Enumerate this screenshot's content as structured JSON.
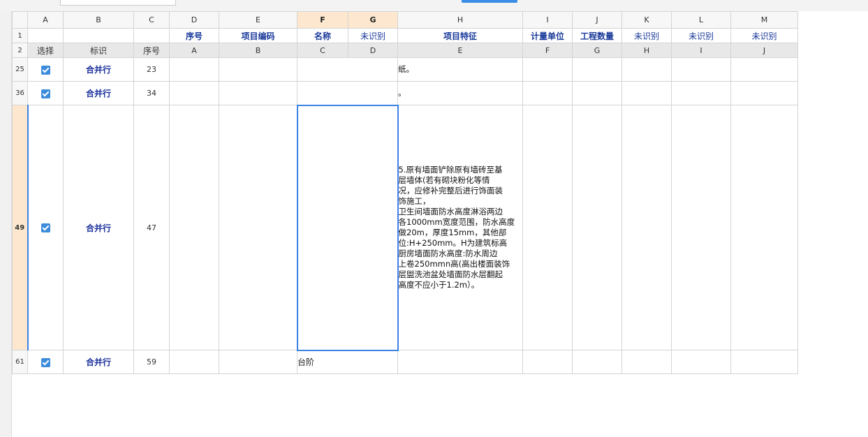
{
  "columns": [
    "A",
    "B",
    "C",
    "D",
    "E",
    "F",
    "G",
    "H",
    "I",
    "J",
    "K",
    "L",
    "M"
  ],
  "header_row1": {
    "row_num": "1",
    "A": "",
    "B": "",
    "C": "",
    "D": "序号",
    "E": "项目编码",
    "F": "名称",
    "G": "未识别",
    "H": "项目特征",
    "I": "计量单位",
    "J": "工程数量",
    "K": "未识别",
    "L": "未识别",
    "M": "未识别"
  },
  "header_row2": {
    "row_num": "2",
    "A": "选择",
    "B": "标识",
    "C": "序号",
    "D": "A",
    "E": "B",
    "F": "C",
    "G": "D",
    "H": "E",
    "I": "F",
    "J": "G",
    "K": "H",
    "L": "I",
    "M": "J"
  },
  "rows": [
    {
      "row_num": "25",
      "checked": true,
      "tag": "合并行",
      "seq": "23",
      "name": "",
      "desc": [
        "纸。"
      ]
    },
    {
      "row_num": "36",
      "checked": true,
      "tag": "合并行",
      "seq": "34",
      "name": "",
      "desc": [
        "。"
      ]
    },
    {
      "row_num": "49",
      "checked": true,
      "tag": "合并行",
      "seq": "47",
      "name": "",
      "desc": [
        "5.原有墙面铲除原有墙砖至基",
        "层墙体(若有砌块粉化等情",
        "况，应修补完整后进行饰面装",
        "饰施工，",
        "卫生间墙面防水高度淋浴两边",
        "各1000mm宽度范围，防水高度",
        "做20m，厚度15mm，其他部",
        "位:H+250mm。H为建筑标高",
        "厨房墙面防水高度:防水周边",
        "上卷250mmn高(高出楼面装饰",
        "层盥洗池盆处墙面防水层翻起",
        "高度不应小于1.2m）。"
      ]
    },
    {
      "row_num": "61",
      "checked": true,
      "tag": "合并行",
      "seq": "59",
      "name": "台阶",
      "desc": []
    }
  ],
  "colors": {
    "selection": "#3b82e6",
    "header_text": "#1a3a9a",
    "checkbox": "#3d8bdb",
    "selected_header": "#fde8cf"
  }
}
